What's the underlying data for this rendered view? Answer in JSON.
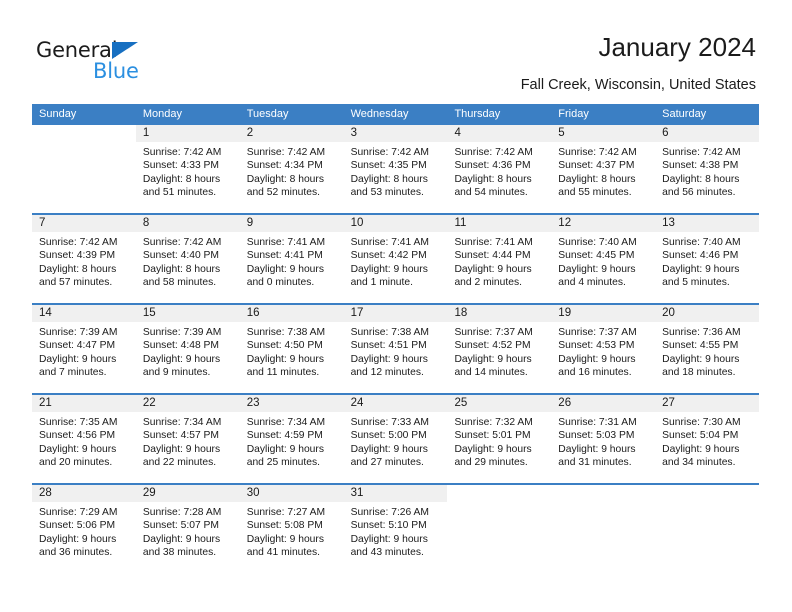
{
  "brand": {
    "name_part1": "General",
    "name_part2": "Blue",
    "triangle_icon": "triangle-icon",
    "accent_dark": "#176fc1",
    "accent_light": "#2b8fe0"
  },
  "header": {
    "title": "January 2024",
    "subtitle": "Fall Creek, Wisconsin, United States"
  },
  "calendar": {
    "header_color": "#3b7fc4",
    "weekdays": [
      "Sunday",
      "Monday",
      "Tuesday",
      "Wednesday",
      "Thursday",
      "Friday",
      "Saturday"
    ],
    "weeks": [
      [
        {
          "day": "",
          "sunrise": "",
          "sunset": "",
          "daylight_line1": "",
          "daylight_line2": ""
        },
        {
          "day": "1",
          "sunrise": "Sunrise: 7:42 AM",
          "sunset": "Sunset: 4:33 PM",
          "daylight_line1": "Daylight: 8 hours",
          "daylight_line2": "and 51 minutes."
        },
        {
          "day": "2",
          "sunrise": "Sunrise: 7:42 AM",
          "sunset": "Sunset: 4:34 PM",
          "daylight_line1": "Daylight: 8 hours",
          "daylight_line2": "and 52 minutes."
        },
        {
          "day": "3",
          "sunrise": "Sunrise: 7:42 AM",
          "sunset": "Sunset: 4:35 PM",
          "daylight_line1": "Daylight: 8 hours",
          "daylight_line2": "and 53 minutes."
        },
        {
          "day": "4",
          "sunrise": "Sunrise: 7:42 AM",
          "sunset": "Sunset: 4:36 PM",
          "daylight_line1": "Daylight: 8 hours",
          "daylight_line2": "and 54 minutes."
        },
        {
          "day": "5",
          "sunrise": "Sunrise: 7:42 AM",
          "sunset": "Sunset: 4:37 PM",
          "daylight_line1": "Daylight: 8 hours",
          "daylight_line2": "and 55 minutes."
        },
        {
          "day": "6",
          "sunrise": "Sunrise: 7:42 AM",
          "sunset": "Sunset: 4:38 PM",
          "daylight_line1": "Daylight: 8 hours",
          "daylight_line2": "and 56 minutes."
        }
      ],
      [
        {
          "day": "7",
          "sunrise": "Sunrise: 7:42 AM",
          "sunset": "Sunset: 4:39 PM",
          "daylight_line1": "Daylight: 8 hours",
          "daylight_line2": "and 57 minutes."
        },
        {
          "day": "8",
          "sunrise": "Sunrise: 7:42 AM",
          "sunset": "Sunset: 4:40 PM",
          "daylight_line1": "Daylight: 8 hours",
          "daylight_line2": "and 58 minutes."
        },
        {
          "day": "9",
          "sunrise": "Sunrise: 7:41 AM",
          "sunset": "Sunset: 4:41 PM",
          "daylight_line1": "Daylight: 9 hours",
          "daylight_line2": "and 0 minutes."
        },
        {
          "day": "10",
          "sunrise": "Sunrise: 7:41 AM",
          "sunset": "Sunset: 4:42 PM",
          "daylight_line1": "Daylight: 9 hours",
          "daylight_line2": "and 1 minute."
        },
        {
          "day": "11",
          "sunrise": "Sunrise: 7:41 AM",
          "sunset": "Sunset: 4:44 PM",
          "daylight_line1": "Daylight: 9 hours",
          "daylight_line2": "and 2 minutes."
        },
        {
          "day": "12",
          "sunrise": "Sunrise: 7:40 AM",
          "sunset": "Sunset: 4:45 PM",
          "daylight_line1": "Daylight: 9 hours",
          "daylight_line2": "and 4 minutes."
        },
        {
          "day": "13",
          "sunrise": "Sunrise: 7:40 AM",
          "sunset": "Sunset: 4:46 PM",
          "daylight_line1": "Daylight: 9 hours",
          "daylight_line2": "and 5 minutes."
        }
      ],
      [
        {
          "day": "14",
          "sunrise": "Sunrise: 7:39 AM",
          "sunset": "Sunset: 4:47 PM",
          "daylight_line1": "Daylight: 9 hours",
          "daylight_line2": "and 7 minutes."
        },
        {
          "day": "15",
          "sunrise": "Sunrise: 7:39 AM",
          "sunset": "Sunset: 4:48 PM",
          "daylight_line1": "Daylight: 9 hours",
          "daylight_line2": "and 9 minutes."
        },
        {
          "day": "16",
          "sunrise": "Sunrise: 7:38 AM",
          "sunset": "Sunset: 4:50 PM",
          "daylight_line1": "Daylight: 9 hours",
          "daylight_line2": "and 11 minutes."
        },
        {
          "day": "17",
          "sunrise": "Sunrise: 7:38 AM",
          "sunset": "Sunset: 4:51 PM",
          "daylight_line1": "Daylight: 9 hours",
          "daylight_line2": "and 12 minutes."
        },
        {
          "day": "18",
          "sunrise": "Sunrise: 7:37 AM",
          "sunset": "Sunset: 4:52 PM",
          "daylight_line1": "Daylight: 9 hours",
          "daylight_line2": "and 14 minutes."
        },
        {
          "day": "19",
          "sunrise": "Sunrise: 7:37 AM",
          "sunset": "Sunset: 4:53 PM",
          "daylight_line1": "Daylight: 9 hours",
          "daylight_line2": "and 16 minutes."
        },
        {
          "day": "20",
          "sunrise": "Sunrise: 7:36 AM",
          "sunset": "Sunset: 4:55 PM",
          "daylight_line1": "Daylight: 9 hours",
          "daylight_line2": "and 18 minutes."
        }
      ],
      [
        {
          "day": "21",
          "sunrise": "Sunrise: 7:35 AM",
          "sunset": "Sunset: 4:56 PM",
          "daylight_line1": "Daylight: 9 hours",
          "daylight_line2": "and 20 minutes."
        },
        {
          "day": "22",
          "sunrise": "Sunrise: 7:34 AM",
          "sunset": "Sunset: 4:57 PM",
          "daylight_line1": "Daylight: 9 hours",
          "daylight_line2": "and 22 minutes."
        },
        {
          "day": "23",
          "sunrise": "Sunrise: 7:34 AM",
          "sunset": "Sunset: 4:59 PM",
          "daylight_line1": "Daylight: 9 hours",
          "daylight_line2": "and 25 minutes."
        },
        {
          "day": "24",
          "sunrise": "Sunrise: 7:33 AM",
          "sunset": "Sunset: 5:00 PM",
          "daylight_line1": "Daylight: 9 hours",
          "daylight_line2": "and 27 minutes."
        },
        {
          "day": "25",
          "sunrise": "Sunrise: 7:32 AM",
          "sunset": "Sunset: 5:01 PM",
          "daylight_line1": "Daylight: 9 hours",
          "daylight_line2": "and 29 minutes."
        },
        {
          "day": "26",
          "sunrise": "Sunrise: 7:31 AM",
          "sunset": "Sunset: 5:03 PM",
          "daylight_line1": "Daylight: 9 hours",
          "daylight_line2": "and 31 minutes."
        },
        {
          "day": "27",
          "sunrise": "Sunrise: 7:30 AM",
          "sunset": "Sunset: 5:04 PM",
          "daylight_line1": "Daylight: 9 hours",
          "daylight_line2": "and 34 minutes."
        }
      ],
      [
        {
          "day": "28",
          "sunrise": "Sunrise: 7:29 AM",
          "sunset": "Sunset: 5:06 PM",
          "daylight_line1": "Daylight: 9 hours",
          "daylight_line2": "and 36 minutes."
        },
        {
          "day": "29",
          "sunrise": "Sunrise: 7:28 AM",
          "sunset": "Sunset: 5:07 PM",
          "daylight_line1": "Daylight: 9 hours",
          "daylight_line2": "and 38 minutes."
        },
        {
          "day": "30",
          "sunrise": "Sunrise: 7:27 AM",
          "sunset": "Sunset: 5:08 PM",
          "daylight_line1": "Daylight: 9 hours",
          "daylight_line2": "and 41 minutes."
        },
        {
          "day": "31",
          "sunrise": "Sunrise: 7:26 AM",
          "sunset": "Sunset: 5:10 PM",
          "daylight_line1": "Daylight: 9 hours",
          "daylight_line2": "and 43 minutes."
        },
        {
          "day": "",
          "sunrise": "",
          "sunset": "",
          "daylight_line1": "",
          "daylight_line2": ""
        },
        {
          "day": "",
          "sunrise": "",
          "sunset": "",
          "daylight_line1": "",
          "daylight_line2": ""
        },
        {
          "day": "",
          "sunrise": "",
          "sunset": "",
          "daylight_line1": "",
          "daylight_line2": ""
        }
      ]
    ]
  }
}
